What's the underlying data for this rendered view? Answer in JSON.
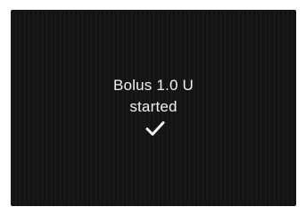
{
  "bolus_notification": {
    "line1": "Bolus 1.0 U",
    "line2": "started",
    "icon": "checkmark-icon"
  },
  "colors": {
    "screen_background": "#141414",
    "text": "#f2f2f2"
  }
}
